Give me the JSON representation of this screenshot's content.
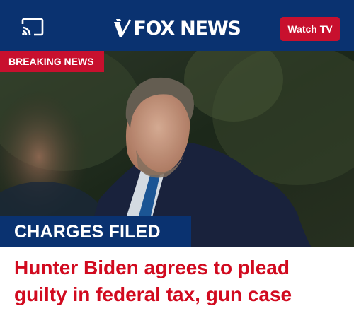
{
  "header": {
    "logo_text": "FOX NEWS",
    "watch_label": "Watch TV",
    "cast_icon": "cast-icon"
  },
  "hero": {
    "breaking_label": "BREAKING NEWS",
    "charges_label": "CHARGES FILED",
    "image_subject": "hunter-biden-photo"
  },
  "article": {
    "headline": "Hunter Biden agrees to plead guilty in federal tax, gun case"
  },
  "colors": {
    "header_bg": "#0a3270",
    "accent_red": "#c8102e",
    "headline_red": "#d10a1f"
  }
}
